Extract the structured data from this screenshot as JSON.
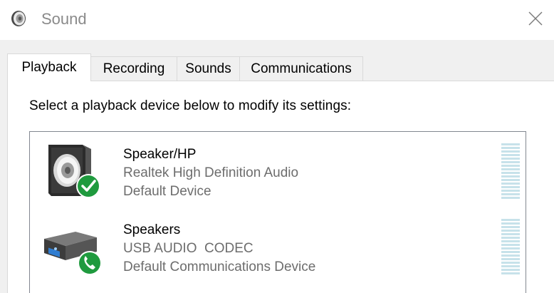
{
  "window": {
    "title": "Sound",
    "title_icon": "speaker-icon",
    "close_icon": "close-icon"
  },
  "tabs": [
    {
      "label": "Playback",
      "active": true
    },
    {
      "label": "Recording",
      "active": false
    },
    {
      "label": "Sounds",
      "active": false
    },
    {
      "label": "Communications",
      "active": false
    }
  ],
  "playback": {
    "instruction": "Select a playback device below to modify its settings:",
    "devices": [
      {
        "name": "Speaker/HP",
        "driver": "Realtek High Definition Audio",
        "status": "Default Device",
        "icon": "speaker-icon",
        "badge_icon": "checkmark-icon",
        "level": 0
      },
      {
        "name": "Speakers",
        "driver": "USB AUDIO  CODEC",
        "status": "Default Communications Device",
        "icon": "usb-audio-device-icon",
        "badge_icon": "phone-icon",
        "level": 0
      }
    ]
  },
  "colors": {
    "badge_green": "#1f9a3e",
    "meter_bar": "#c7e2ea",
    "panel_border": "#d9d9d9"
  }
}
